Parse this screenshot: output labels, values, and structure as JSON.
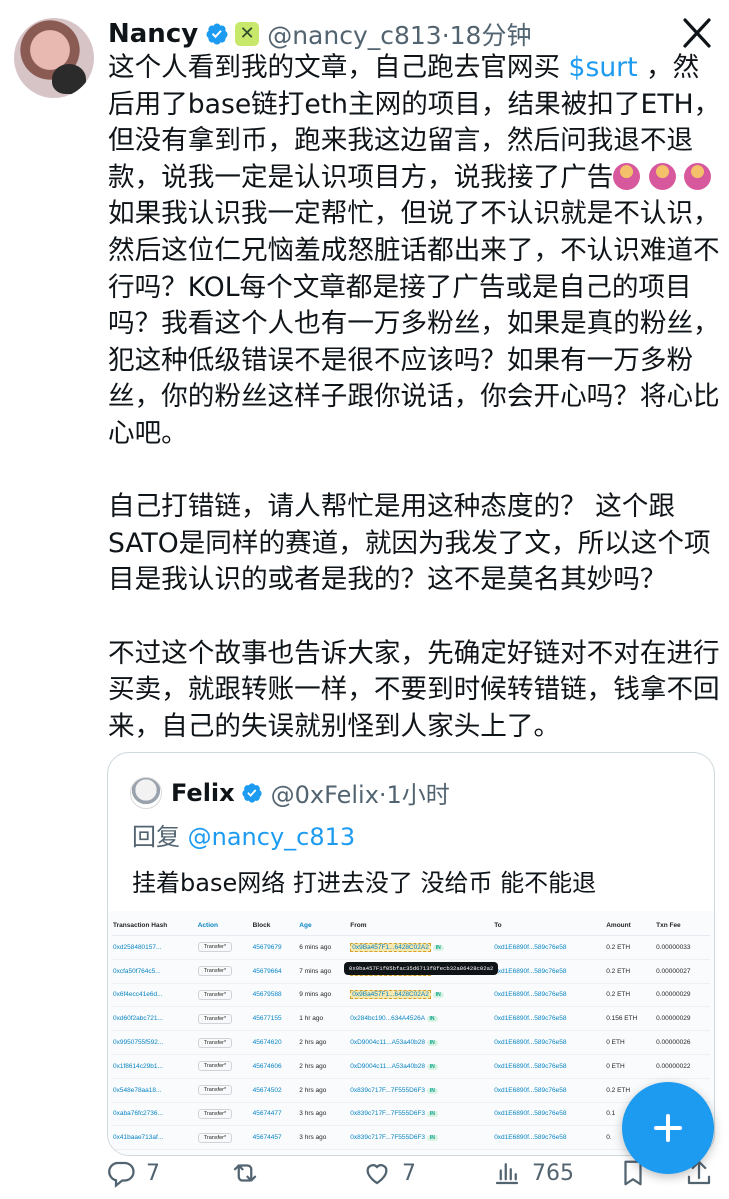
{
  "tweet": {
    "author_name": "Nancy",
    "author_handle_time": "@nancy_c813·18分钟",
    "affiliate_icon": "x-logo",
    "paragraphs": [
      {
        "before": "这个人看到我的文章，自己跑去官网买 ",
        "cashtag": "$surt",
        "mid": " ，然后用了base链打eth主网的项目，结果被扣了ETH，但没有拿到币，跑来我这边留言，然后问我退不退款，说我一定是认识项目方，说我接了广告",
        "after": "如果我认识我一定帮忙，但说了不认识就是不认识，然后这位仁兄恼羞成怒脏话都出来了，不认识难道不行吗？KOL每个文章都是接了广告或是自己的项目吗？我看这个人也有一万多粉丝，如果是真的粉丝，犯这种低级错误不是很不应该吗？如果有一万多粉丝，你的粉丝这样子跟你说话，你会开心吗？将心比心吧。"
      },
      "自己打错链，请人帮忙是用这种态度的？ 这个跟SATO是同样的赛道，就因为我发了文，所以这个项目是我认识的或者是我的？这不是莫名其妙吗？",
      "不过这个故事也告诉大家，先确定好链对不对在进行买卖，就跟转账一样，不要到时候转错链，钱拿不回来，自己的失误就别怪到人家头上了。"
    ],
    "emoji_name": "person-shrugging-emoji"
  },
  "quote": {
    "author_name": "Felix",
    "author_handle_time": "@0xFelix·1小时",
    "reply_prefix": "回复",
    "reply_mention": "@nancy_c813",
    "text": "挂着base网络 打进去没了 没给币 能不能退"
  },
  "tx_table": {
    "headers": [
      "Transaction Hash",
      "Action",
      "Block",
      "Age",
      "From",
      "To",
      "Amount",
      "Txn Fee"
    ],
    "tooltip": "0x9ba457F1f05bfac35d6713f8fecb32a86428c02a2",
    "rows": [
      [
        "0xd258480157...",
        "Transfer*",
        "45679679",
        "6 mins ago",
        "0x9Ba457F1...6428C02A2",
        "0xd1E6890f...589c76e58",
        "0.2 ETH",
        "0.00000033"
      ],
      [
        "0xcfa50f764c5...",
        "Transfer*",
        "45679664",
        "7 mins ago",
        "0x9Ba457F1...6428C02A2",
        "0xd1E6890f...589c76e58",
        "0.2 ETH",
        "0.00000027"
      ],
      [
        "0x6f4ecc41e6d...",
        "Transfer*",
        "45679588",
        "9 mins ago",
        "0x9Ba457F1...6428C02A2",
        "0xd1E6890f...589c76e58",
        "0.2 ETH",
        "0.00000029"
      ],
      [
        "0xd60f2abc721...",
        "Transfer*",
        "45677155",
        "1 hr ago",
        "0x284bc190...634A4526A",
        "0xd1E6890f...589c76e58",
        "0.156 ETH",
        "0.00000029"
      ],
      [
        "0x9950755f592...",
        "Transfer*",
        "45674620",
        "2 hrs ago",
        "0xD9004c11...A53a40b28",
        "0xd1E6890f...589c76e58",
        "0 ETH",
        "0.00000026"
      ],
      [
        "0x1f8614c29b1...",
        "Transfer*",
        "45674606",
        "2 hrs ago",
        "0xD9004c11...A53a40b28",
        "0xd1E6890f...589c76e58",
        "0 ETH",
        "0.00000022"
      ],
      [
        "0x548e78aa18...",
        "Transfer*",
        "45674502",
        "2 hrs ago",
        "0x839c717F...7F555D6F3",
        "0xd1E6890f...589c76e58",
        "0.2 ETH",
        "0.000000"
      ],
      [
        "0xaba76fc2736...",
        "Transfer*",
        "45674477",
        "3 hrs ago",
        "0x839c717F...7F555D6F3",
        "0xd1E6890f...589c76e58",
        "0.1",
        ""
      ],
      [
        "0x41baae713af...",
        "Transfer*",
        "45674457",
        "3 hrs ago",
        "0x839c717F...7F555D6F3",
        "0xd1E6890f...589c76e58",
        "0.",
        ""
      ]
    ]
  },
  "actions": {
    "replies": "7",
    "likes": "7",
    "views": "765"
  }
}
